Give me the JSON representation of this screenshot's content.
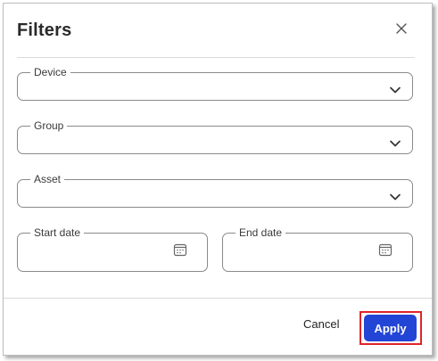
{
  "dialog": {
    "title": "Filters",
    "close_icon": "close-icon"
  },
  "fields": {
    "device": {
      "label": "Device",
      "value": "",
      "icon": "chevron-down-icon"
    },
    "group": {
      "label": "Group",
      "value": "",
      "icon": "chevron-down-icon"
    },
    "asset": {
      "label": "Asset",
      "value": "",
      "icon": "chevron-down-icon"
    },
    "start_date": {
      "label": "Start date",
      "value": "",
      "icon": "calendar-icon"
    },
    "end_date": {
      "label": "End date",
      "value": "",
      "icon": "calendar-icon"
    }
  },
  "footer": {
    "cancel_label": "Cancel",
    "apply_label": "Apply"
  },
  "colors": {
    "primary": "#2345d6",
    "highlight_outline": "#e0242a",
    "border": "#8a8a8a"
  }
}
